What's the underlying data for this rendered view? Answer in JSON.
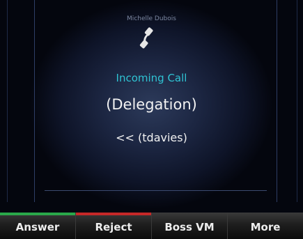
{
  "call": {
    "caller_name": "Michelle Dubois",
    "status": "Incoming Call",
    "type": "(Delegation)",
    "forwarded_from": "<< (tdavies)",
    "icon": "phone-handset-icon"
  },
  "softkeys": [
    {
      "label": "Answer",
      "accent": "#2aa84a"
    },
    {
      "label": "Reject",
      "accent": "#c62828"
    },
    {
      "label": "Boss VM",
      "accent": ""
    },
    {
      "label": "More",
      "accent": ""
    }
  ],
  "colors": {
    "status_text": "#2fc3d3",
    "answer": "#2aa84a",
    "reject": "#c62828"
  }
}
